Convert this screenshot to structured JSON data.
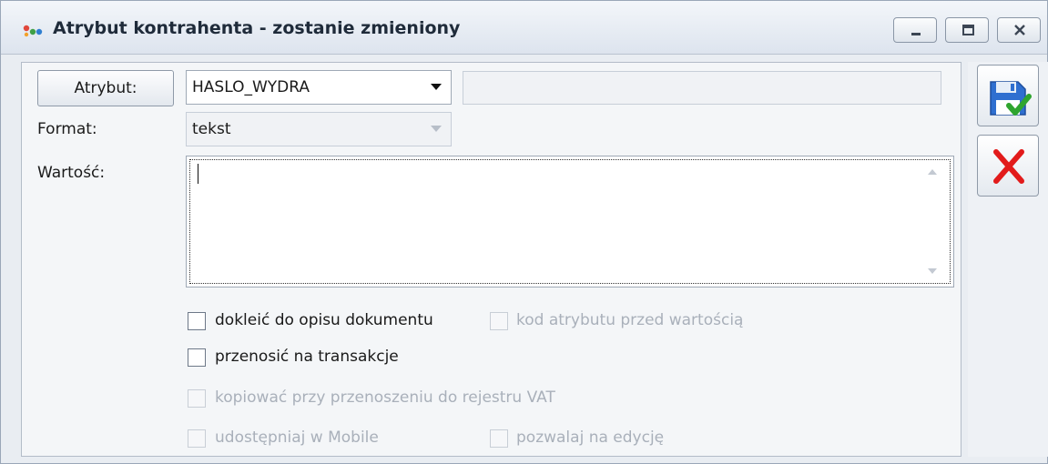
{
  "window": {
    "title": "Atrybut kontrahenta - zostanie zmieniony",
    "controls": [
      "minimize-icon",
      "maximize-icon",
      "close-icon"
    ]
  },
  "form": {
    "atrybut_button": "Atrybut:",
    "atrybut_value": "HASLO_WYDRA",
    "atrybut_description": "",
    "format_label": "Format:",
    "format_value": "tekst",
    "wartosc_label": "Wartość:",
    "wartosc_value": ""
  },
  "checkboxes": {
    "dokleic": {
      "label": "dokleić do opisu dokumentu",
      "checked": false,
      "enabled": true
    },
    "kod_atrybutu": {
      "label": "kod atrybutu przed wartością",
      "checked": false,
      "enabled": false
    },
    "przenosic": {
      "label": "przenosić na transakcje",
      "checked": false,
      "enabled": true
    },
    "kopiowac": {
      "label": "kopiować przy przenoszeniu do rejestru VAT",
      "checked": false,
      "enabled": false
    },
    "udostepniaj": {
      "label": "udostępniaj w Mobile",
      "checked": false,
      "enabled": false
    },
    "pozwalaj": {
      "label": "pozwalaj na edycję",
      "checked": false,
      "enabled": false
    }
  },
  "actions": {
    "save_icon": "save-floppy-check-icon",
    "cancel_icon": "cancel-x-icon"
  },
  "colors": {
    "save_check": "#2fa52f",
    "cancel_red": "#e21b1b"
  }
}
